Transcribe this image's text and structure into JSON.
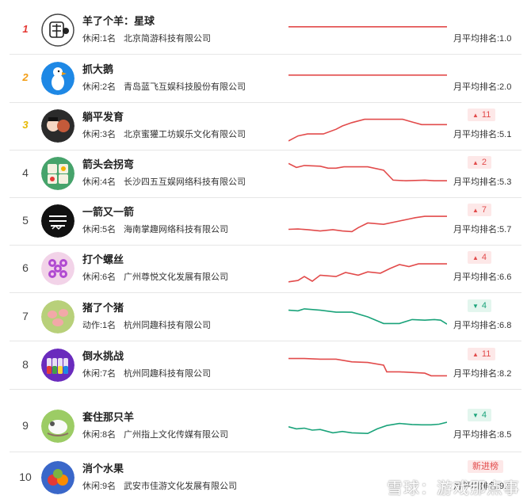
{
  "accent_up": "#e24b4b",
  "accent_down": "#1aa37a",
  "rows": [
    {
      "rank": "1",
      "medal": true,
      "rank_color": "#e53935",
      "name": "羊了个羊：星球",
      "category": "休闲:1名",
      "company": "北京简游科技有限公司",
      "trend": "flat",
      "trend_color": "#e24b4b",
      "avg": "月平均排名:1.0",
      "badge": null,
      "icon": "sheep-logo-icon"
    },
    {
      "rank": "2",
      "medal": true,
      "rank_color": "#f39c12",
      "name": "抓大鹅",
      "category": "休闲:2名",
      "company": "青岛蓝飞互娱科技股份有限公司",
      "trend": "flat",
      "trend_color": "#e24b4b",
      "avg": "月平均排名:2.0",
      "badge": null,
      "icon": "goose-logo-icon"
    },
    {
      "rank": "3",
      "medal": true,
      "rank_color": "#e6b800",
      "name": "躺平发育",
      "category": "休闲:3名",
      "company": "北京蜜獾工坊娱乐文化有限公司",
      "trend": "up",
      "trend_color": "#e24b4b",
      "avg": "月平均排名:5.1",
      "badge": {
        "dir": "up",
        "arrow": "▲",
        "value": "11"
      },
      "icon": "characters-logo-icon"
    },
    {
      "rank": "4",
      "medal": false,
      "name": "箭头会拐弯",
      "category": "休闲:4名",
      "company": "长沙四五互娱网络科技有限公司",
      "trend": "up",
      "trend_color": "#e24b4b",
      "avg": "月平均排名:5.3",
      "badge": {
        "dir": "up",
        "arrow": "▲",
        "value": "2"
      },
      "icon": "tiles-logo-icon"
    },
    {
      "rank": "5",
      "medal": false,
      "name": "一箭又一箭",
      "category": "休闲:5名",
      "company": "海南掌趣网络科技有限公司",
      "trend": "up",
      "trend_color": "#e24b4b",
      "avg": "月平均排名:5.7",
      "badge": {
        "dir": "up",
        "arrow": "▲",
        "value": "7"
      },
      "icon": "arrow-game-logo-icon"
    },
    {
      "rank": "6",
      "medal": false,
      "name": "打个螺丝",
      "category": "休闲:6名",
      "company": "广州尊悦文化发展有限公司",
      "trend": "up",
      "trend_color": "#e24b4b",
      "avg": "月平均排名:6.6",
      "badge": {
        "dir": "up",
        "arrow": "▲",
        "value": "4"
      },
      "icon": "screw-logo-icon"
    },
    {
      "rank": "7",
      "medal": false,
      "name": "猪了个猪",
      "category": "动作:1名",
      "company": "杭州同趣科技有限公司",
      "trend": "down",
      "trend_color": "#1aa37a",
      "avg": "月平均排名:6.8",
      "badge": {
        "dir": "down",
        "arrow": "▼",
        "value": "4"
      },
      "icon": "pig-logo-icon"
    },
    {
      "rank": "8",
      "medal": false,
      "name": "倒水挑战",
      "category": "休闲:7名",
      "company": "杭州同趣科技有限公司",
      "trend": "down2",
      "trend_color": "#e24b4b",
      "avg": "月平均排名:8.2",
      "badge": {
        "dir": "up",
        "arrow": "▲",
        "value": "11"
      },
      "icon": "bottles-logo-icon"
    },
    {
      "rank": "9",
      "medal": false,
      "name": "套住那只羊",
      "category": "休闲:8名",
      "company": "广州指上文化传媒有限公司",
      "trend": "up2",
      "trend_color": "#1aa37a",
      "avg": "月平均排名:8.5",
      "badge": {
        "dir": "down",
        "arrow": "▼",
        "value": "4"
      },
      "icon": "sheep-rope-logo-icon"
    },
    {
      "rank": "10",
      "medal": false,
      "name": "消个水果",
      "category": "休闲:9名",
      "company": "武安市佳游文化发展有限公司",
      "trend": "none",
      "trend_color": "#e24b4b",
      "avg": "月平均排名:9.9",
      "badge": {
        "dir": "new",
        "arrow": "",
        "value": "新进榜"
      },
      "icon": "fruit-logo-icon"
    }
  ],
  "watermark": "雪球：游戏那点事"
}
